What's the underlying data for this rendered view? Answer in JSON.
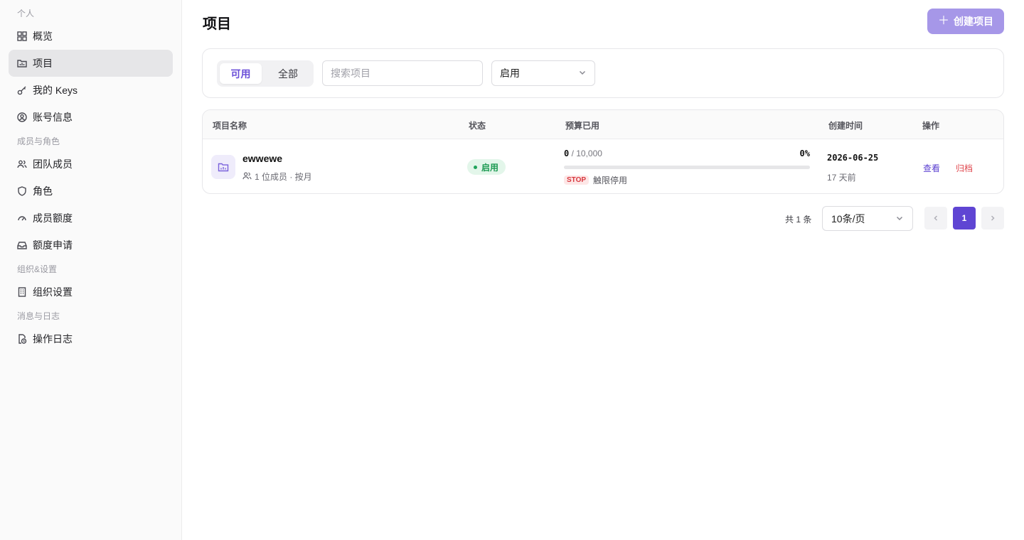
{
  "sidebar": {
    "groups": {
      "personal": "个人",
      "members": "成员与角色",
      "org": "组织&设置",
      "logs": "消息与日志"
    },
    "items": [
      {
        "label": "概览",
        "icon": "grid-icon"
      },
      {
        "label": "项目",
        "icon": "folder-chart-icon"
      },
      {
        "label": "我的 Keys",
        "icon": "key-icon"
      },
      {
        "label": "账号信息",
        "icon": "user-circle-icon"
      },
      {
        "label": "团队成员",
        "icon": "users-icon"
      },
      {
        "label": "角色",
        "icon": "shield-icon"
      },
      {
        "label": "成员额度",
        "icon": "gauge-icon"
      },
      {
        "label": "额度申请",
        "icon": "inbox-icon"
      },
      {
        "label": "组织设置",
        "icon": "building-icon"
      },
      {
        "label": "操作日志",
        "icon": "file-clock-icon"
      }
    ],
    "active": "项目"
  },
  "header": {
    "title": "项目",
    "create_label": "创建项目"
  },
  "filters": {
    "tab_available": "可用",
    "tab_all": "全部",
    "search_placeholder": "搜索项目",
    "status_value": "启用"
  },
  "table": {
    "columns": [
      "项目名称",
      "状态",
      "预算已用",
      "创建时间",
      "操作"
    ],
    "rows": [
      {
        "name": "ewwewe",
        "meta": "1 位成员 · 按月",
        "status": "启用",
        "budget_used": "0",
        "budget_total": "/ 10,000",
        "budget_pct": "0%",
        "budget_fraction": 0,
        "stop_badge": "STOP",
        "stop_text": "触限停用",
        "created_date": "2026-06-25",
        "created_rel": "17 天前",
        "action_view": "查看",
        "action_archive": "归档"
      }
    ]
  },
  "pagination": {
    "total": "共 1 条",
    "page_size": "10条/页",
    "current": "1"
  },
  "colors": {
    "accent": "#5f45d3",
    "create_button": "#a697e8",
    "status_green": "#1d9a52",
    "danger": "#e0484f"
  }
}
